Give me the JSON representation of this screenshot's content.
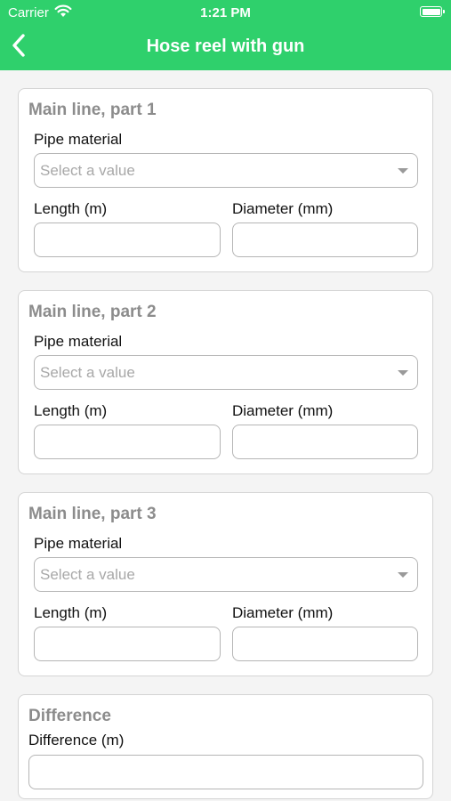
{
  "status_bar": {
    "carrier": "Carrier",
    "time": "1:21 PM"
  },
  "nav": {
    "title": "Hose reel with gun",
    "back_icon": "chevron-left-icon"
  },
  "sections": [
    {
      "title": "Main line, part 1",
      "pipe_label": "Pipe material",
      "pipe_placeholder": "Select a value",
      "length_label": "Length (m)",
      "length_value": "",
      "diameter_label": "Diameter (mm)",
      "diameter_value": ""
    },
    {
      "title": "Main line, part 2",
      "pipe_label": "Pipe material",
      "pipe_placeholder": "Select a value",
      "length_label": "Length (m)",
      "length_value": "",
      "diameter_label": "Diameter (mm)",
      "diameter_value": ""
    },
    {
      "title": "Main line, part 3",
      "pipe_label": "Pipe material",
      "pipe_placeholder": "Select a value",
      "length_label": "Length (m)",
      "length_value": "",
      "diameter_label": "Diameter (mm)",
      "diameter_value": ""
    }
  ],
  "difference": {
    "title": "Difference",
    "label": "Difference (m)",
    "value": ""
  },
  "colors": {
    "header": "#2fd06c",
    "background": "#f4f4f4",
    "section_title": "#8c8c8c",
    "border": "#b5b5b5"
  }
}
